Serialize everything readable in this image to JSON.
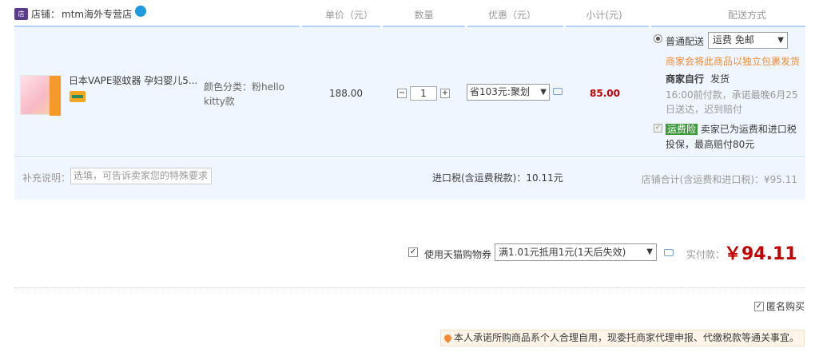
{
  "shop": {
    "label": "店铺：",
    "name": "mtm海外专营店"
  },
  "columns": [
    "单价（元）",
    "数量",
    "优惠（元）",
    "小计(元)",
    "配送方式"
  ],
  "item": {
    "title": "日本VAPE驱蚊器 孕妇婴儿5...",
    "sku": "颜色分类：粉hello kitty款",
    "price": "188.00",
    "quantity": "1",
    "qty_minus": "−",
    "qty_plus": "+",
    "discount": "省103元:聚划",
    "subtotal": "85.00"
  },
  "shipping": {
    "mode": "普通配送",
    "fee_option": "运费 免邮",
    "note": "商家会将此商品以独立包裹发货",
    "who": "商家自行",
    "who_action": "发货",
    "time": "16:00前付款，承诺最晚6月25日送达，迟到赔付",
    "insurance_badge": "运费险",
    "insurance_text": "卖家已为运费和进口税投保，最高赔付80元"
  },
  "memo": {
    "label": "补充说明：",
    "placeholder": "选填，可告诉卖家您的特殊要求"
  },
  "tax": "进口税(含运费税款)：10.11元",
  "shop_total": "店铺合计(含运费和进口税)：¥95.11",
  "coupon": {
    "label": "使用天猫购物券",
    "option": "满1.01元抵用1元(1天后失效)"
  },
  "payment": {
    "label": "实付款：",
    "amount": "￥94.11"
  },
  "anonymous": "匿名购买",
  "notice": "本人承诺所购商品系个人合理自用，现委托商家代理申报、代缴税款等通关事宜。"
}
